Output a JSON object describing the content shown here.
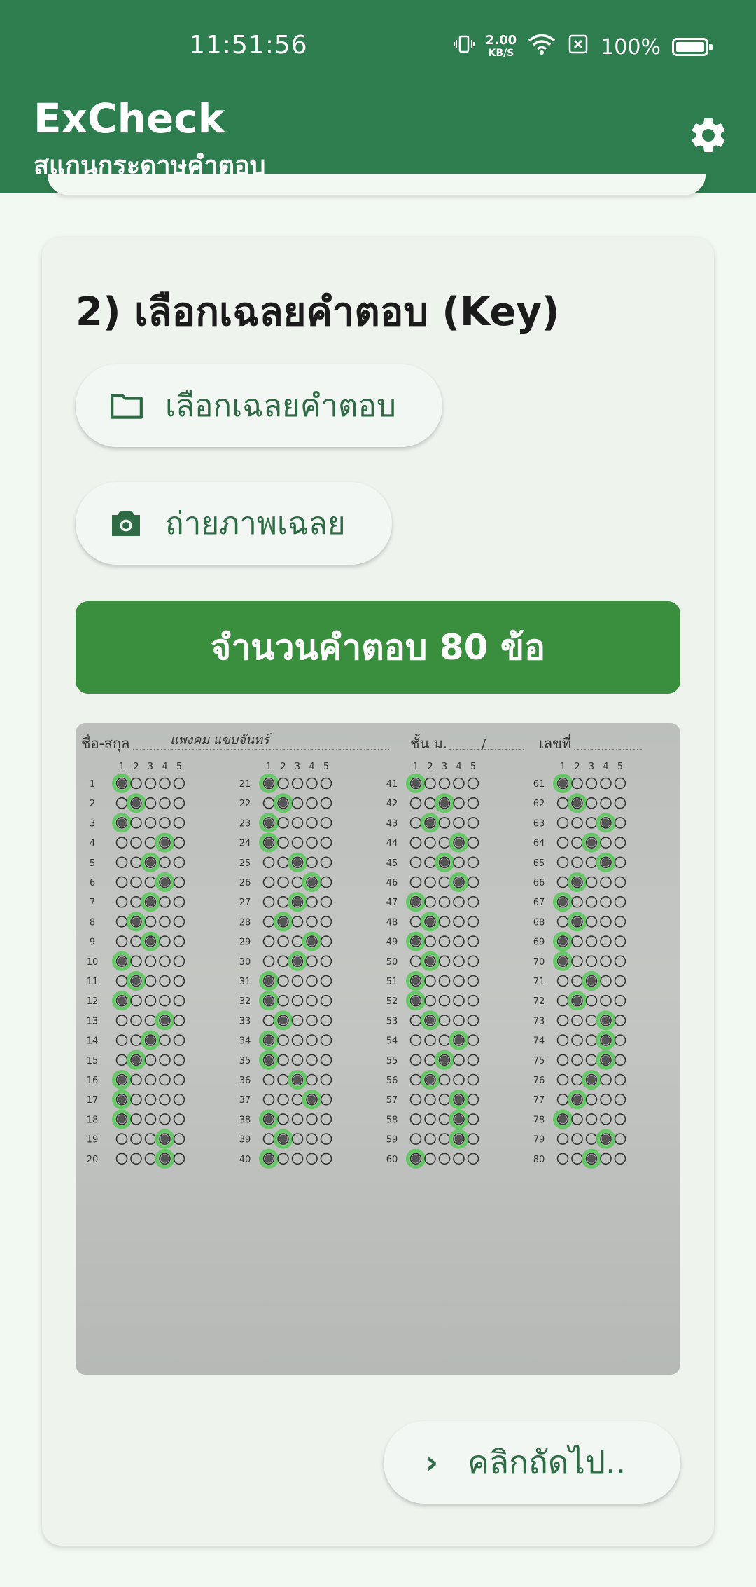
{
  "status_bar": {
    "time": "11:51:56",
    "net_speed_value": "2.00",
    "net_speed_unit": "KB/S",
    "battery": "100%",
    "icons": [
      "vibrate-icon",
      "wifi-icon",
      "sim-off-icon",
      "battery-icon"
    ]
  },
  "app_bar": {
    "title": "ExCheck",
    "subtitle": "สแกนกระดาษคำตอบ",
    "settings_icon": "gear-icon"
  },
  "card": {
    "title": "2) เลือกเฉลยคำตอบ (Key)",
    "choose_key_button": "เลือกเฉลยคำตอบ",
    "photo_key_button": "ถ่ายภาพเฉลย",
    "answer_count_banner": "จำนวนคำตอบ  80 ข้อ",
    "next_button": "คลิกถัดไป.."
  },
  "answer_sheet": {
    "header_name_label": "ชื่อ-สกุล",
    "header_name_value": "แพงคม แขบจันทร์",
    "header_class_label": "ชั้น ม.",
    "header_class_sep": "/",
    "header_number_label": "เลขที่",
    "choice_labels": [
      "1",
      "2",
      "3",
      "4",
      "5"
    ],
    "questions_per_column": 20,
    "answers": [
      1,
      2,
      1,
      4,
      3,
      4,
      3,
      2,
      3,
      1,
      2,
      1,
      4,
      3,
      2,
      1,
      1,
      1,
      4,
      4,
      1,
      2,
      1,
      1,
      3,
      4,
      3,
      2,
      4,
      3,
      1,
      1,
      2,
      1,
      1,
      3,
      4,
      1,
      2,
      1,
      1,
      3,
      2,
      4,
      3,
      4,
      1,
      2,
      1,
      2,
      1,
      1,
      2,
      4,
      3,
      2,
      4,
      4,
      4,
      1,
      1,
      2,
      4,
      3,
      4,
      2,
      1,
      2,
      1,
      1,
      3,
      2,
      4,
      4,
      4,
      3,
      2,
      1,
      4,
      3
    ],
    "highlight_color": "#5cc85c"
  }
}
